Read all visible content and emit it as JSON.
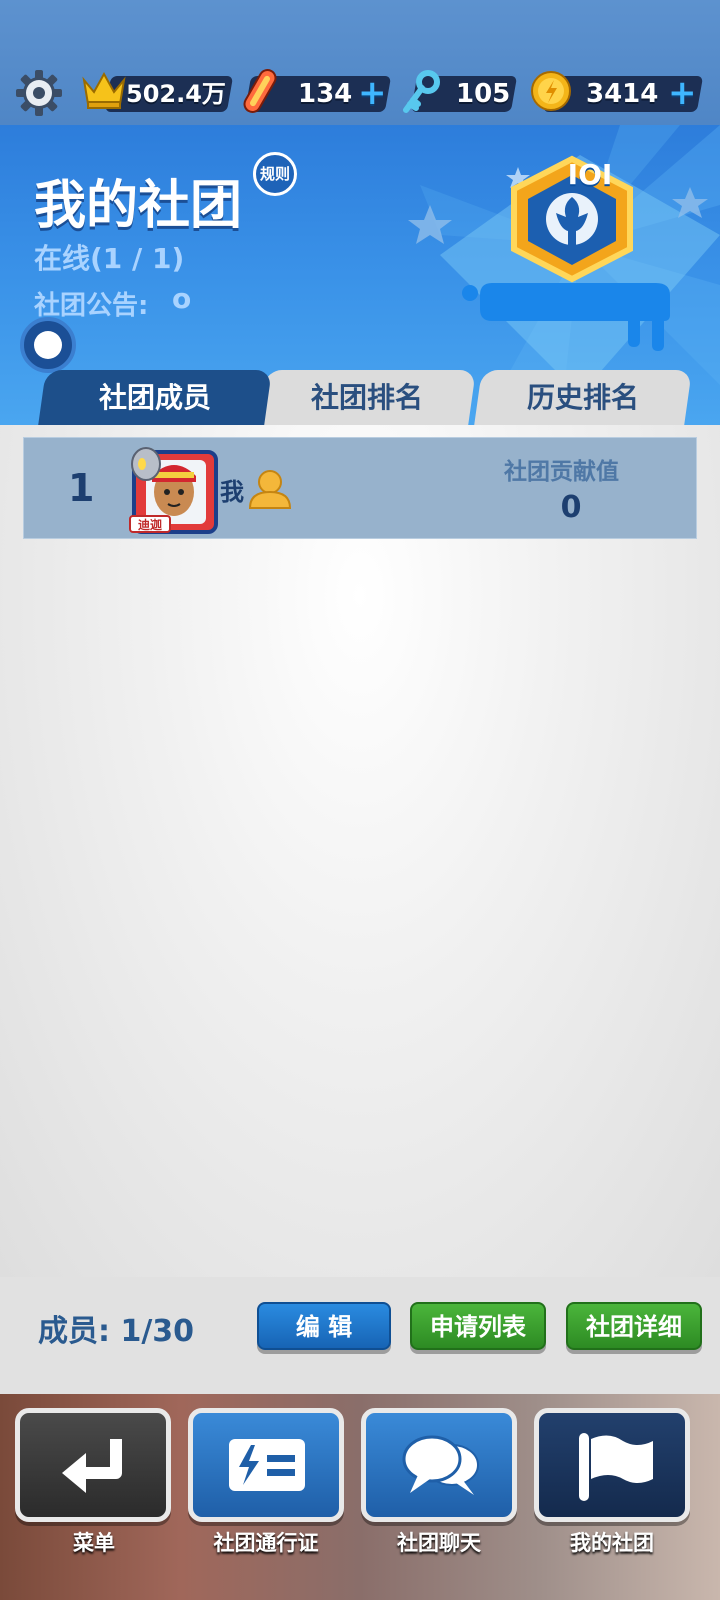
{
  "resources": {
    "crowns": "502.4万",
    "boards": "134",
    "keys": "105",
    "coins": "3414",
    "plus": "+"
  },
  "club": {
    "title": "我的社团",
    "rules": "规则",
    "online": "在线(1 / 1)",
    "notice_label": "社团公告:",
    "notice_value": "o",
    "badge_level": "IOI"
  },
  "tabs": [
    {
      "label": "社团成员",
      "active": true
    },
    {
      "label": "社团排名",
      "active": false
    },
    {
      "label": "历史排名",
      "active": false
    }
  ],
  "members": [
    {
      "rank": "1",
      "name": "我",
      "contribution_label": "社团贡献值",
      "contribution": "0",
      "avatar_tag": "迪迦"
    }
  ],
  "footer": {
    "members_count": "成员:  1/30",
    "edit": "编 辑",
    "apply_list": "申请列表",
    "club_detail": "社团详细"
  },
  "nav": [
    {
      "label": "菜单",
      "icon": "return-arrow-icon",
      "color": "#3a3a3a"
    },
    {
      "label": "社团通行证",
      "icon": "pass-ticket-icon",
      "color": "#2f77c3"
    },
    {
      "label": "社团聊天",
      "icon": "chat-bubbles-icon",
      "color": "#2f77c3"
    },
    {
      "label": "我的社团",
      "icon": "flag-icon",
      "color": "#1b2f55"
    }
  ],
  "colors": {
    "accent_blue": "#2d7ddb",
    "dark_navy": "#1d4f8a",
    "green_button": "#2d8b23"
  }
}
